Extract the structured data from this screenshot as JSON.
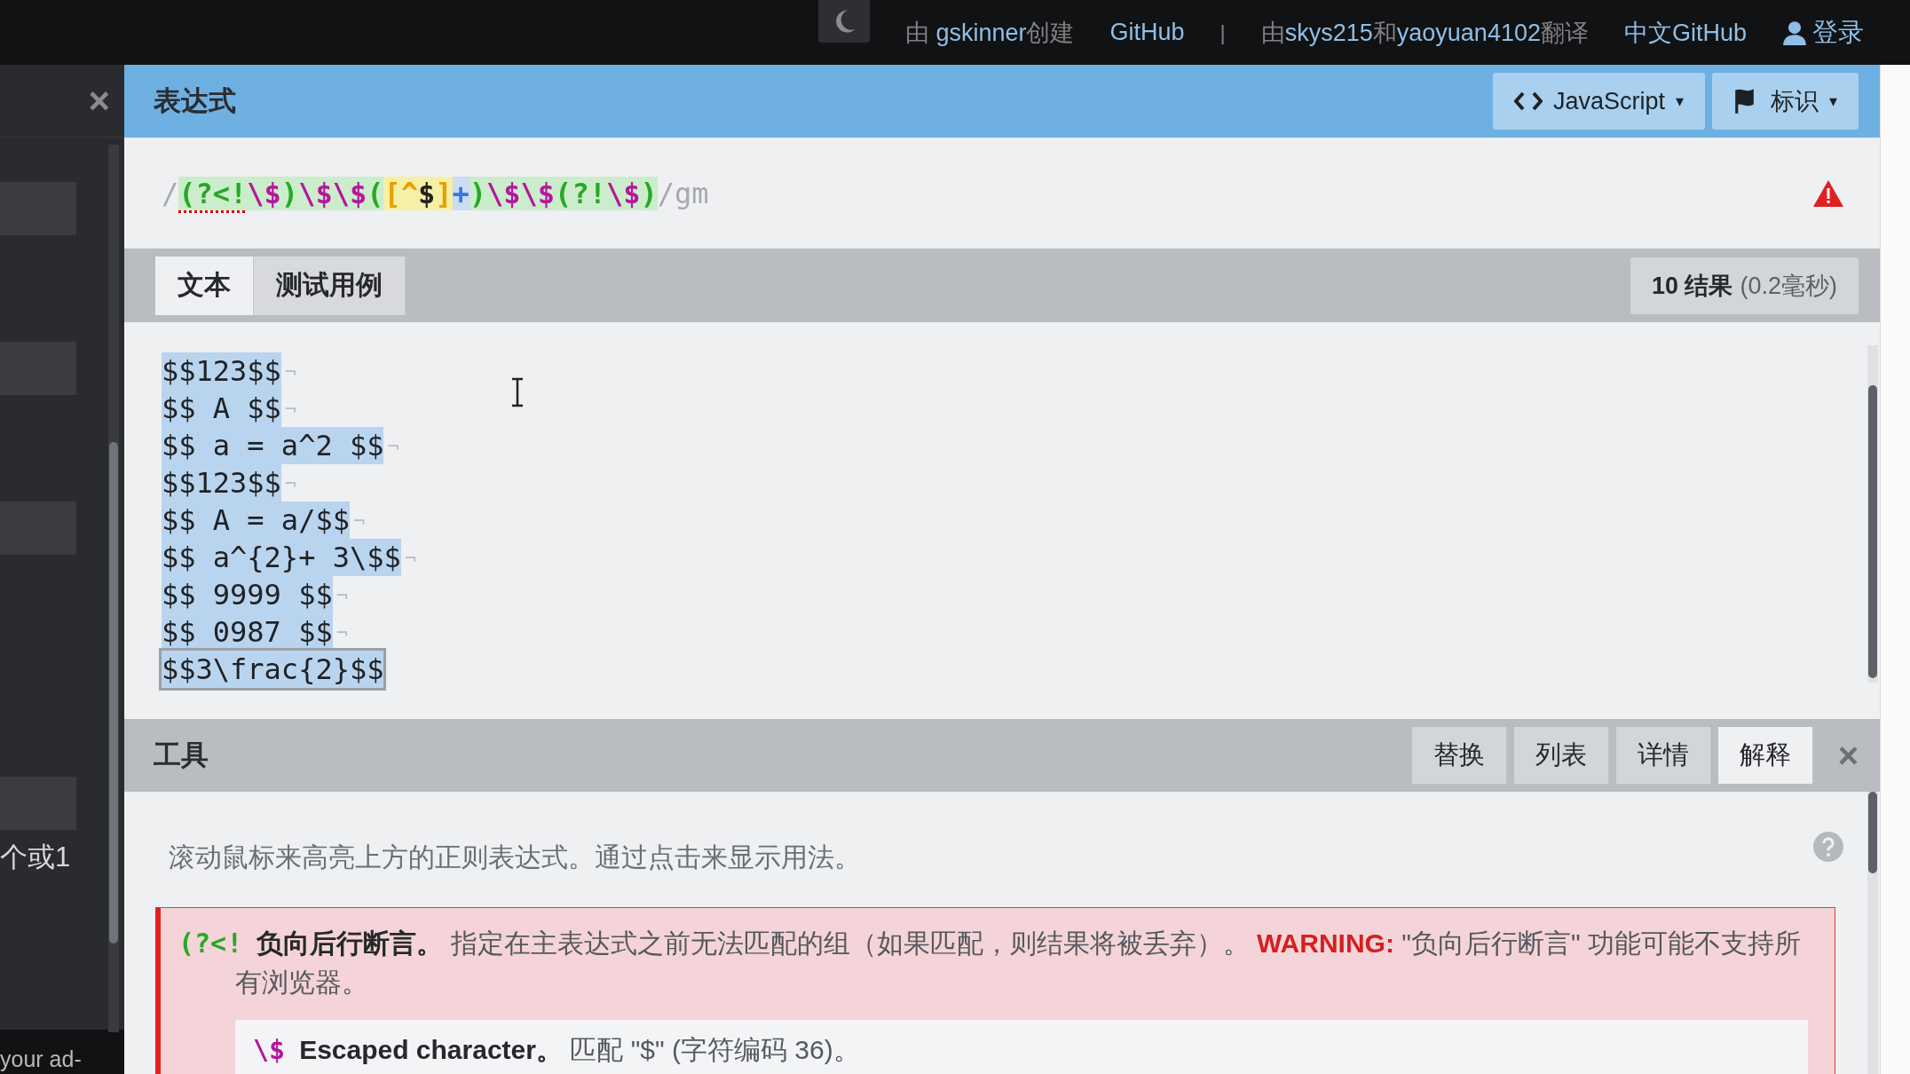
{
  "top_bar": {
    "theme_toggle": {
      "on": true
    },
    "credits": [
      {
        "kind": "text",
        "text": "由 "
      },
      {
        "kind": "link",
        "text": "gskinner"
      },
      {
        "kind": "text",
        "text": "创建"
      }
    ],
    "links_1": "GitHub",
    "separator": "|",
    "translators": [
      {
        "kind": "text",
        "text": "由"
      },
      {
        "kind": "link",
        "text": "skys215"
      },
      {
        "kind": "text",
        "text": "和"
      },
      {
        "kind": "link",
        "text": "yaoyuan4102"
      },
      {
        "kind": "text",
        "text": "翻译"
      }
    ],
    "links_2": "中文GitHub",
    "login": "登录"
  },
  "sidebar": {
    "close": "×",
    "fragments": [
      {
        "text": "个或1"
      },
      {
        "text": "your ad-"
      }
    ]
  },
  "expression": {
    "title": "表达式",
    "flavor": "JavaScript",
    "flavor_caret": "▾",
    "flags_button": "标识",
    "flags_caret": "▾",
    "error": true,
    "tokens": [
      {
        "kind": "delimiter",
        "text": "/"
      },
      {
        "kind": "group",
        "text": "(?<!",
        "warn": true
      },
      {
        "kind": "escape",
        "text": "\\$"
      },
      {
        "kind": "group",
        "text": ")"
      },
      {
        "kind": "escape",
        "text": "\\$\\$"
      },
      {
        "kind": "group",
        "text": "("
      },
      {
        "kind": "set",
        "text": "[^"
      },
      {
        "kind": "setchar",
        "text": "$"
      },
      {
        "kind": "set",
        "text": "]"
      },
      {
        "kind": "quantifier",
        "text": "+"
      },
      {
        "kind": "group",
        "text": ")"
      },
      {
        "kind": "escape",
        "text": "\\$\\$"
      },
      {
        "kind": "group",
        "text": "(?!"
      },
      {
        "kind": "escape",
        "text": "\\$"
      },
      {
        "kind": "group",
        "text": ")"
      },
      {
        "kind": "flags",
        "text": "/gm"
      }
    ]
  },
  "test_tabs": [
    {
      "label": "文本",
      "selected": true
    },
    {
      "label": "测试用例",
      "selected": false
    }
  ],
  "result": {
    "count": "10 结果",
    "time": "(0.2毫秒)"
  },
  "test_lines": [
    {
      "text": "$$123$$",
      "end_mark": "¬",
      "hovered": false
    },
    {
      "text": "$$ A $$",
      "end_mark": "¬",
      "hovered": false
    },
    {
      "text": "$$ a = a^2 $$",
      "end_mark": "¬",
      "hovered": false
    },
    {
      "text": "$$123$$",
      "end_mark": "¬",
      "hovered": false
    },
    {
      "text": "$$ A = a/$$",
      "end_mark": "¬",
      "hovered": false
    },
    {
      "text": "$$ a^{2}+ 3\\$$",
      "end_mark": "¬",
      "hovered": false
    },
    {
      "text": "$$ 9999 $$",
      "end_mark": "¬",
      "hovered": false
    },
    {
      "text": "$$ 0987 $$",
      "end_mark": "¬",
      "hovered": false
    },
    {
      "text": "$$3\\frac{2}$$",
      "hovered": true
    }
  ],
  "tools": {
    "title": "工具",
    "tabs": [
      {
        "label": "替换",
        "selected": false
      },
      {
        "label": "列表",
        "selected": false
      },
      {
        "label": "详情",
        "selected": false
      },
      {
        "label": "解释",
        "selected": true
      }
    ],
    "close": "×",
    "hint": "滚动鼠标来高亮上方的正则表达式。通过点击来显示用法。",
    "explanation": {
      "token": "(?<!",
      "title": "负向后行断言。",
      "body": "指定在主表达式之前无法匹配的组（如果匹配，则结果将被丢弃）。",
      "warning_label": "WARNING:",
      "warning": "\"负向后行断言\" 功能可能不支持所有浏览器。",
      "child": {
        "token": "\\$",
        "title": "Escaped character。",
        "body": "匹配 \"$\" (字符编码 36)。"
      }
    }
  }
}
